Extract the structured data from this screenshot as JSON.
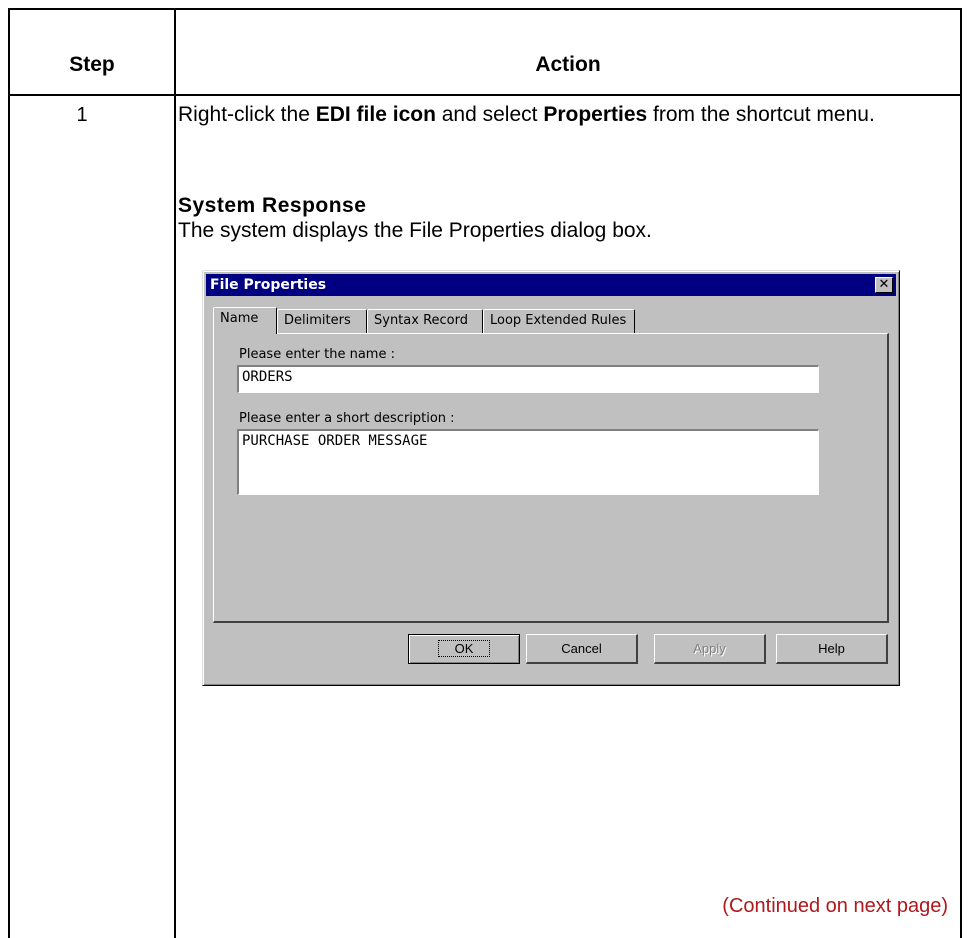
{
  "table": {
    "header_step": "Step",
    "header_action": "Action",
    "step_number": "1",
    "instruction": {
      "part1": "Right-click the ",
      "bold1": "EDI file icon",
      "part2": " and select ",
      "bold2": "Properties",
      "part3": " from the shortcut menu."
    },
    "system_response_heading": "System Response",
    "system_response_text": "The system displays the File Properties dialog box.",
    "continued": "(Continued on next page)"
  },
  "dialog": {
    "title": "File Properties",
    "close_glyph": "✕",
    "tabs": [
      "Name",
      "Delimiters",
      "Syntax Record",
      "Loop Extended Rules"
    ],
    "active_tab": "Name",
    "name_label": "Please enter the name :",
    "name_value": "ORDERS",
    "description_label": "Please enter a short description :",
    "description_value": "PURCHASE ORDER MESSAGE",
    "buttons": {
      "ok": "OK",
      "cancel": "Cancel",
      "apply": "Apply",
      "help": "Help"
    }
  },
  "colors": {
    "titlebar": "#000080",
    "dialog_face": "#c0c0c0",
    "continued_text": "#b0181c"
  }
}
